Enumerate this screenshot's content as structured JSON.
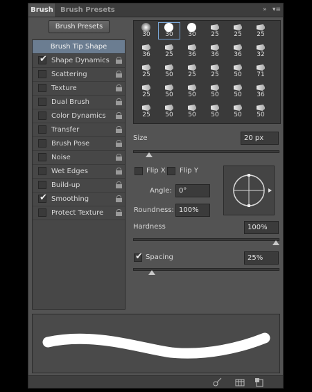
{
  "tabs": {
    "active": "Brush",
    "inactive": "Brush Presets"
  },
  "tabbar_icons": {
    "collapse": "»",
    "menu": "▾≡"
  },
  "brush_presets_button": "Brush Presets",
  "sidebar": {
    "header": "Brush Tip Shape",
    "items": [
      {
        "label": "Shape Dynamics",
        "checked": true
      },
      {
        "label": "Scattering",
        "checked": false
      },
      {
        "label": "Texture",
        "checked": false
      },
      {
        "label": "Dual Brush",
        "checked": false
      },
      {
        "label": "Color Dynamics",
        "checked": false
      },
      {
        "label": "Transfer",
        "checked": false
      },
      {
        "label": "Brush Pose",
        "checked": false
      },
      {
        "label": "Noise",
        "checked": false
      },
      {
        "label": "Wet Edges",
        "checked": false
      },
      {
        "label": "Build-up",
        "checked": false
      },
      {
        "label": "Smoothing",
        "checked": true
      },
      {
        "label": "Protect Texture",
        "checked": false
      }
    ],
    "checkmark": "✔"
  },
  "brush_sizes": [
    "30",
    "30",
    "30",
    "25",
    "25",
    "25",
    "36",
    "25",
    "36",
    "36",
    "36",
    "32",
    "25",
    "50",
    "25",
    "25",
    "50",
    "71",
    "25",
    "50",
    "50",
    "50",
    "50",
    "36",
    "25",
    "50",
    "50",
    "50",
    "50",
    "50"
  ],
  "selected_brush_index": 1,
  "size": {
    "label": "Size",
    "value": "20 px",
    "fraction": 0.09
  },
  "flip_x": {
    "label": "Flip X",
    "checked": false
  },
  "flip_y": {
    "label": "Flip Y",
    "checked": false
  },
  "angle": {
    "label": "Angle:",
    "value": "0°"
  },
  "roundness": {
    "label": "Roundness:",
    "value": "100%"
  },
  "hardness": {
    "label": "Hardness",
    "value": "100%",
    "fraction": 1.0
  },
  "spacing": {
    "label": "Spacing",
    "value": "25%",
    "checked": true,
    "fraction": 0.11
  },
  "colors": {
    "accent": "#6b7d91",
    "panel": "#535353",
    "selection": "#7aa7d8"
  }
}
